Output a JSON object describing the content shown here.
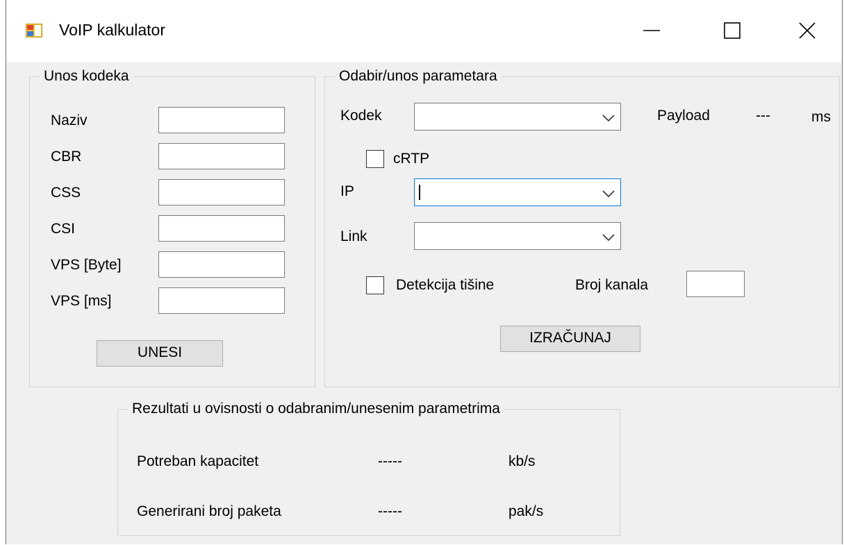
{
  "window": {
    "title": "VoIP kalkulator",
    "icons": {
      "app": "app-form-icon",
      "minimize": "minimize-icon",
      "maximize": "maximize-icon",
      "close": "close-icon"
    }
  },
  "codec_group": {
    "legend": "Unos kodeka",
    "fields": [
      {
        "label": "Naziv",
        "value": ""
      },
      {
        "label": "CBR",
        "value": ""
      },
      {
        "label": "CSS",
        "value": ""
      },
      {
        "label": "CSI",
        "value": ""
      },
      {
        "label": "VPS [Byte]",
        "value": ""
      },
      {
        "label": "VPS [ms]",
        "value": ""
      }
    ],
    "submit_label": "UNESI"
  },
  "params_group": {
    "legend": "Odabir/unos parametara",
    "codec_label": "Kodek",
    "codec_value": "",
    "payload_label": "Payload",
    "payload_value": "---",
    "payload_unit": "ms",
    "crtp_label": "cRTP",
    "crtp_checked": false,
    "ip_label": "IP",
    "ip_value": "",
    "link_label": "Link",
    "link_value": "",
    "silence_label": "Detekcija tišine",
    "silence_checked": false,
    "channels_label": "Broj kanala",
    "channels_value": "",
    "calculate_label": "IZRAČUNAJ"
  },
  "results_group": {
    "legend": "Rezultati u ovisnosti o odabranim/unesenim parametrima",
    "rows": [
      {
        "label": "Potreban kapacitet",
        "value": "-----",
        "unit": "kb/s"
      },
      {
        "label": "Generirani broj paketa",
        "value": "-----",
        "unit": "pak/s"
      }
    ]
  }
}
